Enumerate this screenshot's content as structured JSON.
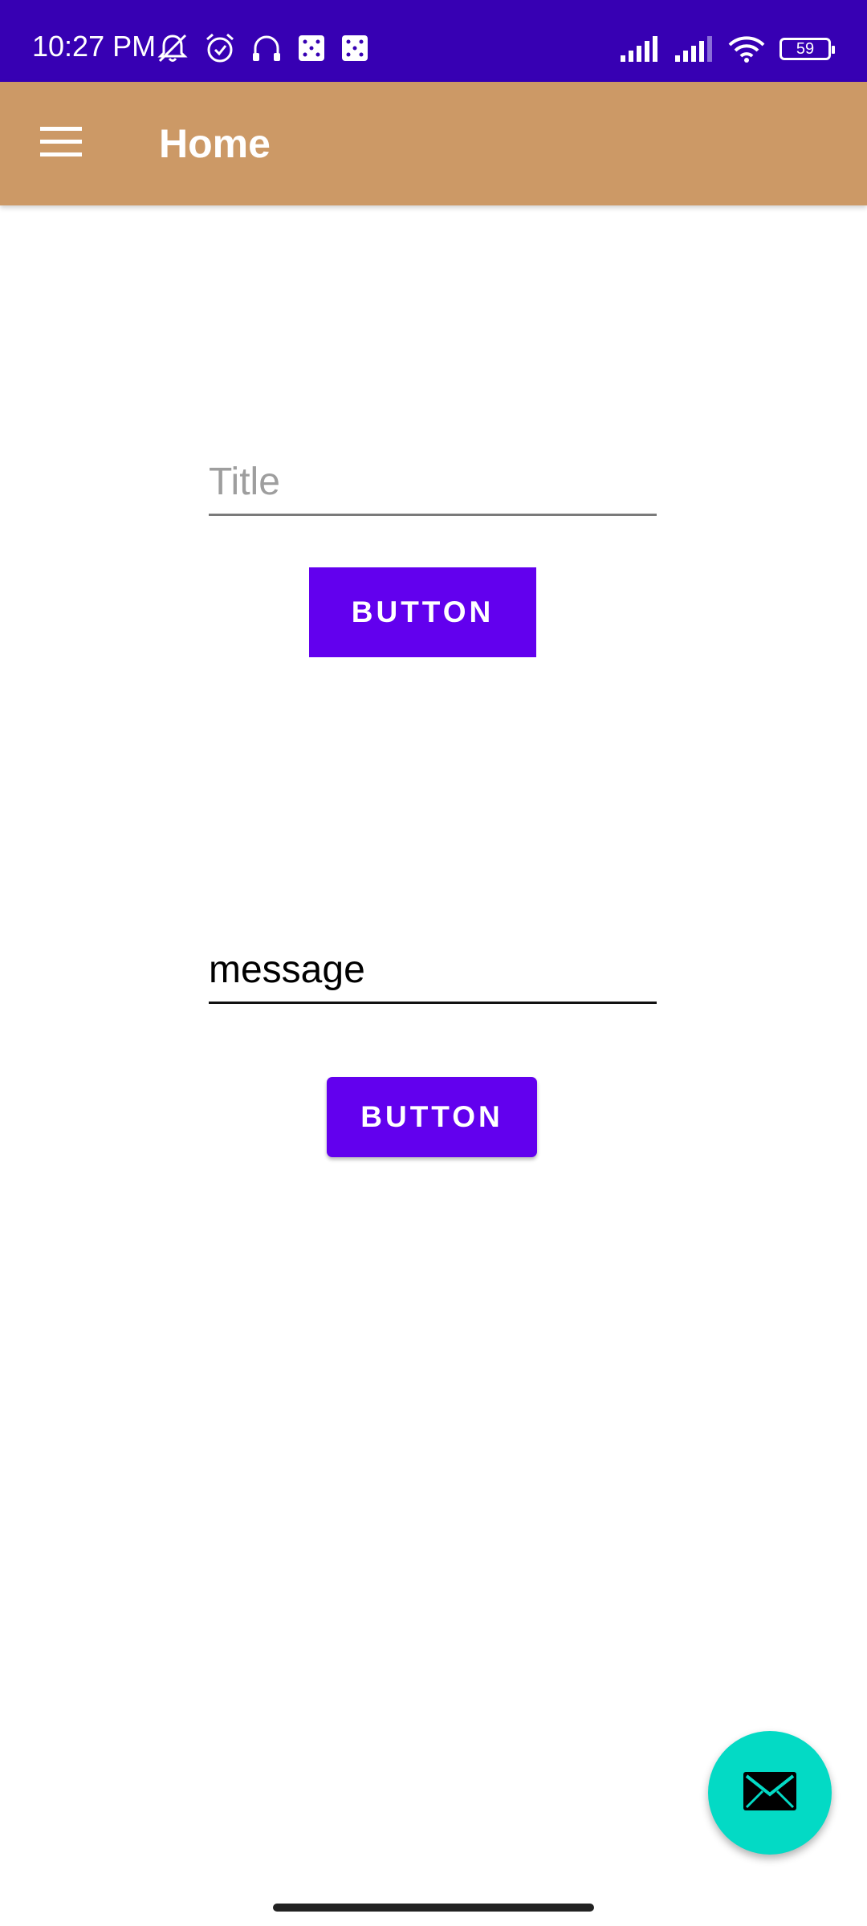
{
  "status_bar": {
    "time": "10:27 PM",
    "battery_level": "59",
    "icons_left": [
      "mute-icon",
      "alarm-icon",
      "headphones-icon",
      "app-notification-icon",
      "app-notification-icon"
    ],
    "icons_right": [
      "signal-icon",
      "signal-icon",
      "wifi-icon",
      "battery-icon"
    ]
  },
  "app_bar": {
    "title": "Home",
    "menu_icon": "hamburger-menu-icon"
  },
  "form": {
    "title_field": {
      "placeholder": "Title",
      "value": ""
    },
    "button_one_label": "BUTTON",
    "message_field": {
      "placeholder": "",
      "value": "message"
    },
    "button_two_label": "BUTTON"
  },
  "fab": {
    "icon": "email-icon"
  },
  "colors": {
    "status_bar": "#3700B3",
    "app_bar": "#CC9966",
    "button": "#6200EE",
    "fab": "#03DAC5"
  }
}
